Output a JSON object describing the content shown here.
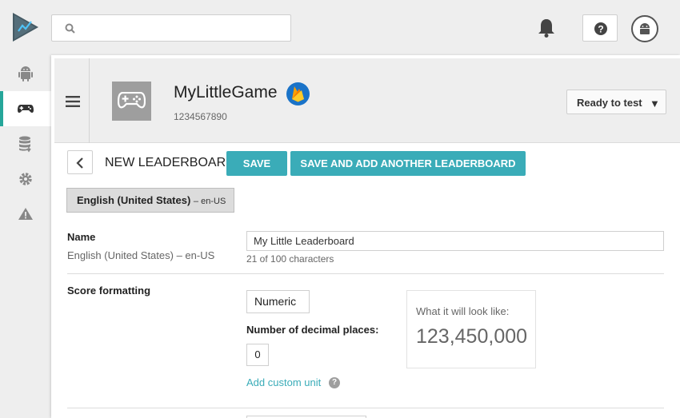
{
  "header": {
    "search": {
      "placeholder": ""
    },
    "icons": {
      "logo": "play-console-logo",
      "search": "search-icon",
      "notifications": "bell-icon",
      "help": "help-icon",
      "account": "android-avatar-icon"
    }
  },
  "sidebar": {
    "items": [
      {
        "name": "android",
        "icon": "android-icon",
        "active": false
      },
      {
        "name": "game-services",
        "icon": "gamepad-icon",
        "active": true
      },
      {
        "name": "database",
        "icon": "database-icon",
        "active": false
      },
      {
        "name": "settings",
        "icon": "gear-icon",
        "active": false
      },
      {
        "name": "alerts",
        "icon": "warning-icon",
        "active": false
      }
    ],
    "active_color": "#26a69a"
  },
  "app": {
    "name": "MyLittleGame",
    "id": "1234567890",
    "status": "Ready to test",
    "status_caret": "▼"
  },
  "form": {
    "title": "NEW LEADERBOARD",
    "save_label": "SAVE",
    "save_add_label": "SAVE AND ADD ANOTHER LEADERBOARD",
    "locale_tab": {
      "language": "English (United States)",
      "code": "– en-US"
    },
    "name_field": {
      "label": "Name",
      "sublabel": "English (United States) – en-US",
      "value": "My Little Leaderboard",
      "hint": "21 of 100 characters"
    },
    "score_formatting": {
      "label": "Score formatting",
      "format": "Numeric",
      "decimal_label": "Number of decimal places:",
      "decimal_value": "0",
      "custom_unit_link": "Add custom unit",
      "help_glyph": "?",
      "preview_caption": "What it will look like:",
      "preview_value": "123,450,000"
    }
  },
  "colors": {
    "accent": "#3aacb8",
    "firebase_badge": "#1a73c8"
  }
}
